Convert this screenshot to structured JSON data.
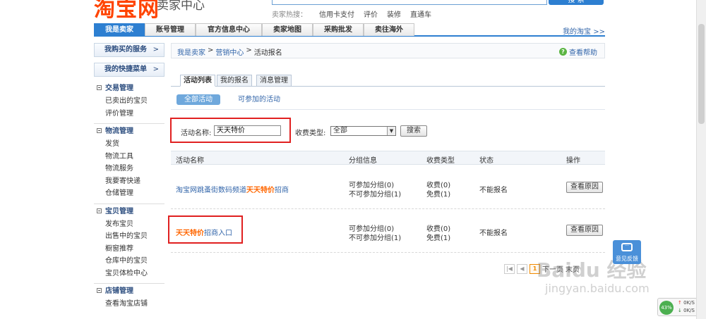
{
  "header": {
    "logo": "淘宝网",
    "logo_sub": "卖家中心",
    "search_button": "搜 索",
    "hot_label": "卖家热搜：",
    "hot_words": [
      "信用卡支付",
      "评价",
      "装修",
      "直通车"
    ]
  },
  "mainnav": {
    "tabs": [
      "我是卖家",
      "账号管理",
      "官方信息中心",
      "卖家地图",
      "采购批发",
      "卖往海外"
    ],
    "active_index": 0,
    "right_link": "我的淘宝 >>"
  },
  "sidebar": {
    "buttons": [
      {
        "label": "我购买的服务",
        "arrow": ">"
      },
      {
        "label": "我的快捷菜单",
        "arrow": ">"
      }
    ],
    "groups": [
      {
        "title": "交易管理",
        "items": [
          "已卖出的宝贝",
          "评价管理"
        ]
      },
      {
        "title": "物流管理",
        "items": [
          "发货",
          "物流工具",
          "物流服务",
          "我要寄快递",
          "仓储管理"
        ]
      },
      {
        "title": "宝贝管理",
        "items": [
          "发布宝贝",
          "出售中的宝贝",
          "橱窗推荐",
          "仓库中的宝贝",
          "宝贝体检中心"
        ]
      },
      {
        "title": "店铺管理",
        "items": [
          "查看淘宝店铺"
        ]
      }
    ]
  },
  "breadcrumb": {
    "items": [
      "我是卖家",
      "营销中心",
      "活动报名"
    ],
    "sep": ">",
    "help": "查看帮助",
    "help_icon": "?"
  },
  "subtabs": [
    "活动列表",
    "我的报名",
    "消息管理"
  ],
  "chips": [
    "全部活动",
    "可参加的活动"
  ],
  "form": {
    "name_label": "活动名称:",
    "name_value": "天天特价",
    "fee_label": "收费类型:",
    "fee_value": "全部",
    "search_button": "搜索"
  },
  "table": {
    "headers": [
      "活动名称",
      "分组信息",
      "收费类型",
      "状态",
      "操作"
    ],
    "rows": [
      {
        "title_pre": "淘宝网跳蚤街数码频道",
        "title_hl": "天天特价",
        "title_post": "招商",
        "group_a": "可参加分组(0)",
        "group_b": "不可参加分组(1)",
        "fee_a": "收费(0)",
        "fee_b": "免费(1)",
        "status": "不能报名",
        "action": "查看原因"
      },
      {
        "title_pre": "",
        "title_hl": "天天特价",
        "title_post": "招商入口",
        "group_a": "可参加分组(0)",
        "group_b": "不可参加分组(1)",
        "fee_a": "收费(0)",
        "fee_b": "免费(1)",
        "status": "不能报名",
        "action": "查看原因"
      }
    ]
  },
  "pager": {
    "first": "|◀",
    "prev": "◀",
    "current": "1",
    "next_text": "下一页",
    "last_text": "末页"
  },
  "widgets": {
    "feedback": "意见反馈",
    "net_percent": "43%",
    "net_up": "0K/S",
    "net_down": "0K/S"
  },
  "watermark": {
    "main": "Baidu 经验",
    "sub": "jingyan.baidu.com"
  },
  "colors": {
    "brand_orange": "#ff4400",
    "nav_blue": "#2d7fd1",
    "link_blue": "#3366aa",
    "highlight_orange": "#ff6600",
    "annotation_red": "#e02020"
  }
}
